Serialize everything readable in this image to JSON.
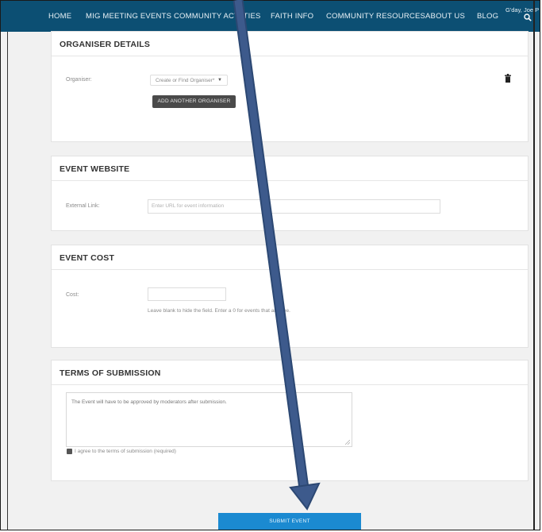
{
  "nav": {
    "items": [
      {
        "label": "HOME"
      },
      {
        "label": "MIG MEETING EVENTS"
      },
      {
        "label": "COMMUNITY ACTI TIES"
      },
      {
        "label": "FAITH INFO"
      },
      {
        "label": "COMMUNITY RESOURCES"
      },
      {
        "label": "ABOUT US"
      },
      {
        "label": "BLOG"
      }
    ],
    "greeting": "G'day, Joe P"
  },
  "organiser": {
    "title": "ORGANISER DETAILS",
    "label": "Organiser:",
    "select_value": "Create or Find Organiser*",
    "add_button": "ADD ANOTHER ORGANISER"
  },
  "website": {
    "title": "EVENT WEBSITE",
    "label": "External Link:",
    "placeholder": "Enter URL for event information"
  },
  "cost": {
    "title": "EVENT COST",
    "label": "Cost:",
    "value": "",
    "help": "Leave blank to hide the field. Enter a 0 for events that are free."
  },
  "terms": {
    "title": "TERMS OF SUBMISSION",
    "text": "The Event will have to be approved by moderators after submission.",
    "agree_label": "I agree to the terms of submission (required)",
    "agree_checked": true
  },
  "submit_label": "SUBMIT EVENT",
  "colors": {
    "nav_bg": "#0c4f73",
    "submit_bg": "#1b8ad1",
    "arrow": "#3d5a8c"
  }
}
